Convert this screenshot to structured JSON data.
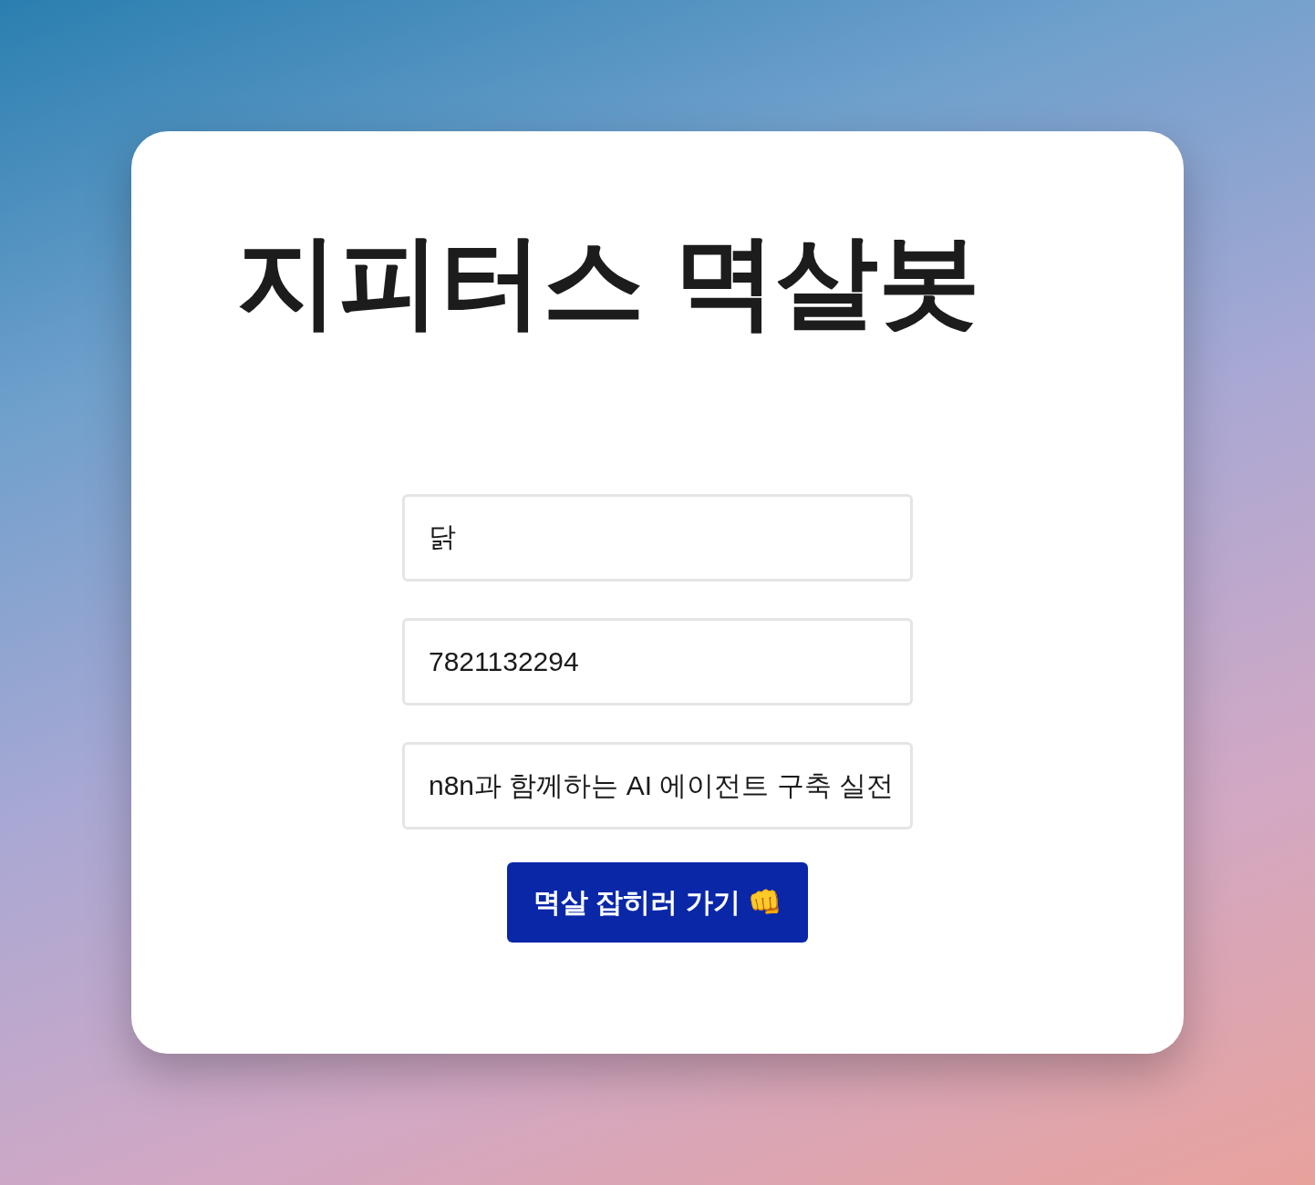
{
  "title": "지피터스 멱살봇",
  "form": {
    "name_value": "닭",
    "phone_value": "7821132294",
    "course_value": "n8n과 함께하는 AI 에이전트 구축 실전 ",
    "submit_label": "멱살 잡히러 가기 👊"
  }
}
